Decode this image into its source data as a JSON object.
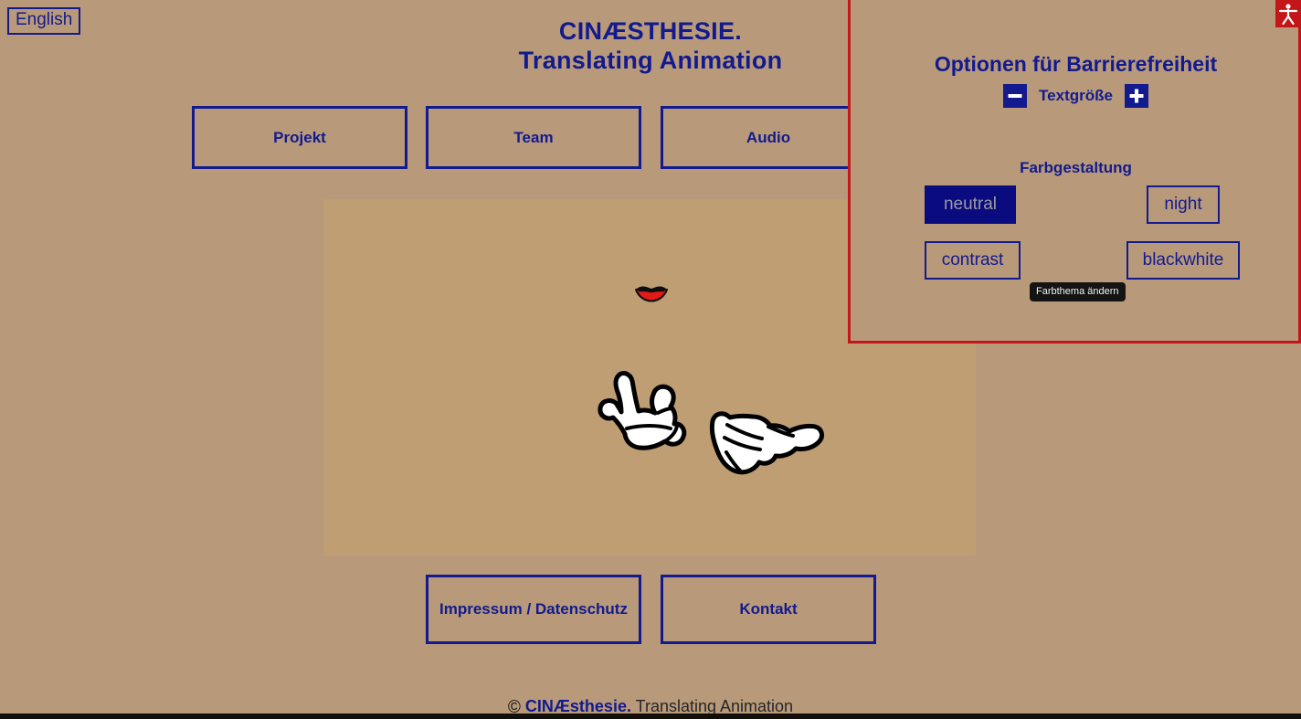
{
  "page": {
    "background_color": "#b89a7a",
    "stage_color": "#bf9e74",
    "accent_blue": "#121a8e",
    "accent_red": "#c41618"
  },
  "language_toggle": {
    "label": "English"
  },
  "site_title": {
    "line1": "CINÆSTHESIE.",
    "line2": "Translating Animation"
  },
  "top_nav": {
    "items": [
      {
        "label": "Projekt"
      },
      {
        "label": "Team"
      },
      {
        "label": "Audio"
      }
    ]
  },
  "content_stage": {
    "illustrations": [
      {
        "name": "red-lips"
      },
      {
        "name": "signing-hands"
      }
    ]
  },
  "footer_nav": {
    "items": [
      {
        "label": "Impressum / Datenschutz"
      },
      {
        "label": "Kontakt"
      }
    ]
  },
  "copyright": {
    "symbol": "©",
    "brand": "CINÆsthesie.",
    "tagline": " Translating Animation"
  },
  "accessibility_panel": {
    "title": "Optionen für Barrierefreiheit",
    "text_size": {
      "decrease_label": "−",
      "label": "Textgröße",
      "increase_label": "+"
    },
    "color_scheme": {
      "title": "Farbgestaltung",
      "options": [
        {
          "label": "neutral",
          "active": true
        },
        {
          "label": "night",
          "active": false
        },
        {
          "label": "contrast",
          "active": false
        },
        {
          "label": "blackwhite",
          "active": false
        }
      ],
      "tooltip": "Farbthema ändern"
    },
    "launcher_icon": "accessibility-person-icon"
  }
}
